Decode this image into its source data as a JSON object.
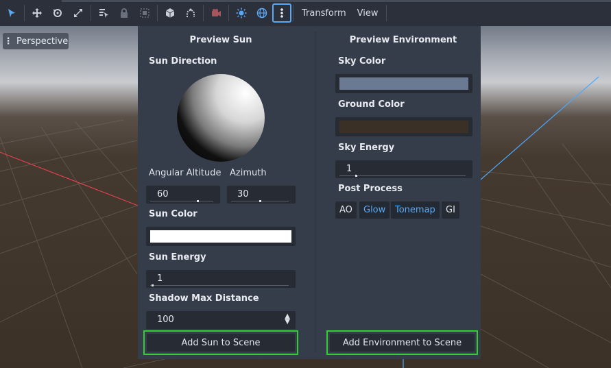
{
  "toolbar": {
    "icons": [
      "select-icon",
      "move-icon",
      "rotate-icon",
      "scale-icon",
      "list-select-icon",
      "lock-icon",
      "group-icon",
      "camera-cube-icon",
      "snap-icon",
      "preview-camera-icon",
      "sun-icon",
      "globe-icon",
      "more-icon"
    ],
    "menus": [
      "Transform",
      "View"
    ]
  },
  "viewport": {
    "perspective_label": "Perspective"
  },
  "preview_sun": {
    "title": "Preview Sun",
    "sun_direction_label": "Sun Direction",
    "angular_altitude_label": "Angular Altitude",
    "azimuth_label": "Azimuth",
    "angular_altitude_value": "60",
    "angular_altitude_fraction": 0.75,
    "azimuth_value": "30",
    "azimuth_fraction": 0.5,
    "sun_color_label": "Sun Color",
    "sun_color": "#ffffff",
    "sun_energy_label": "Sun Energy",
    "sun_energy_value": "1",
    "shadow_max_distance_label": "Shadow Max Distance",
    "shadow_max_distance_value": "100",
    "add_button": "Add Sun to Scene"
  },
  "preview_environment": {
    "title": "Preview Environment",
    "sky_color_label": "Sky Color",
    "sky_color": "#6b7a93",
    "ground_color_label": "Ground Color",
    "ground_color": "#3a3026",
    "sky_energy_label": "Sky Energy",
    "sky_energy_value": "1",
    "post_process_label": "Post Process",
    "post_process": {
      "ao": "AO",
      "glow": "Glow",
      "tonemap": "Tonemap",
      "gi": "GI"
    },
    "add_button": "Add Environment to Scene"
  },
  "colors": {
    "accent": "#5aa9f5",
    "highlight_border": "#2fd02f"
  }
}
